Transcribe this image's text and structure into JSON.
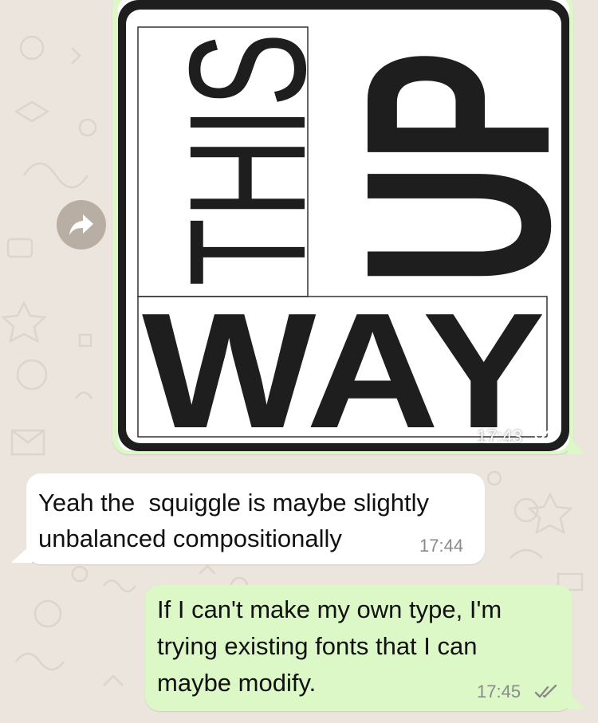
{
  "chat": {
    "messages": [
      {
        "direction": "outgoing",
        "kind": "image",
        "image_words": [
          "THIS",
          "UP",
          "WAY"
        ],
        "time": "17:43",
        "status": "read"
      },
      {
        "direction": "incoming",
        "kind": "text",
        "text": "Yeah the  squiggle is maybe slightly\nunbalanced compositionally",
        "time": "17:44"
      },
      {
        "direction": "outgoing",
        "kind": "text",
        "text": "If I can't make my own type, I'm trying existing fonts that I can maybe modify.",
        "time": "17:45",
        "status": "read"
      }
    ]
  },
  "colors": {
    "wallpaper": "#ece5dd",
    "outgoing_bubble": "#dcf8c6",
    "incoming_bubble": "#ffffff",
    "forward_button": "#b9aea3",
    "poster_ink": "#1e1e1e"
  },
  "icons": {
    "forward": "forward-arrow-icon",
    "read_receipt": "double-check-icon"
  }
}
